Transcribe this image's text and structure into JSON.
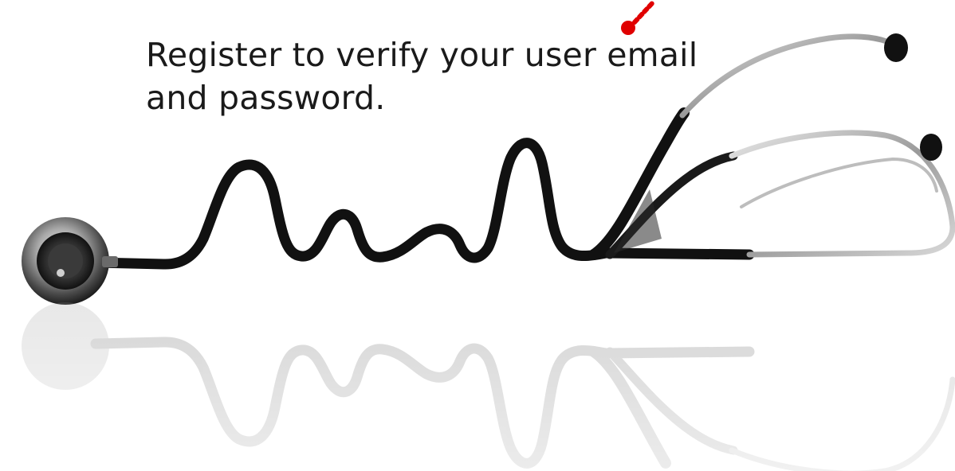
{
  "message": {
    "line1": "Register to verify your user email",
    "line2": "and password."
  },
  "illustration": {
    "icon": "stethoscope-heartbeat-icon",
    "reflection_icon": "stethoscope-reflection-icon",
    "pointer_icon": "red-dot-pointer-icon"
  },
  "colors": {
    "background": "#ffffff",
    "text": "#1a1a1a",
    "tube": "#111111",
    "metal": "#9a9a9a",
    "pointer": "#e00000"
  }
}
